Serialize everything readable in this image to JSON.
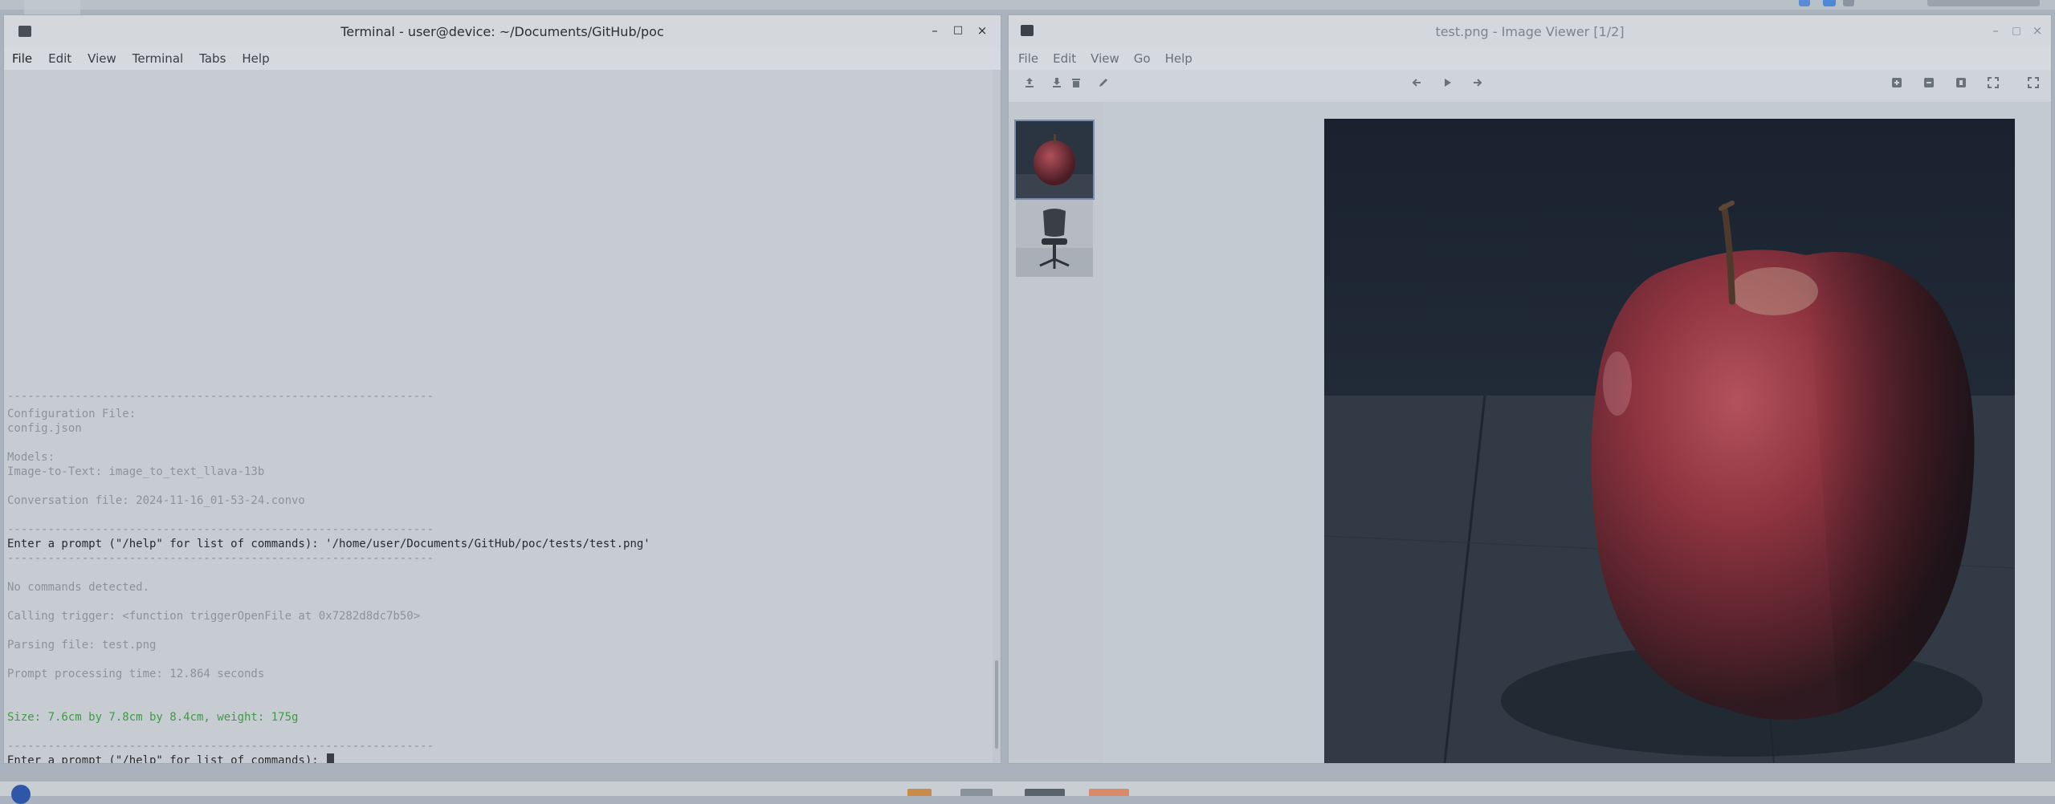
{
  "terminal": {
    "title": "Terminal - user@device: ~/Documents/GitHub/poc",
    "menu": [
      "File",
      "Edit",
      "View",
      "Terminal",
      "Tabs",
      "Help"
    ],
    "controls": {
      "minimize": "–",
      "maximize": "□",
      "close": "×"
    },
    "lines": {
      "sep1": "---------------------------------------------------------------",
      "config_label": "Configuration File:",
      "config_value": "config.json",
      "models_label": "Models:",
      "model_line": "Image-to-Text: image_to_text_llava-13b",
      "conversation": "Conversation file: 2024-11-16_01-53-24.convo",
      "sep2": "---------------------------------------------------------------",
      "prompt1": "Enter a prompt (\"/help\" for list of commands): '/home/user/Documents/GitHub/poc/tests/test.png'",
      "sep3": "---------------------------------------------------------------",
      "no_commands": "No commands detected.",
      "calling": "Calling trigger: <function triggerOpenFile at 0x7282d8dc7b50>",
      "parsing": "Parsing file: test.png",
      "processing": "Prompt processing time: 12.864 seconds",
      "result": "Size: 7.6cm by 7.8cm by 8.4cm, weight: 175g",
      "sep4": "---------------------------------------------------------------",
      "prompt2": "Enter a prompt (\"/help\" for list of commands): "
    }
  },
  "viewer": {
    "title": "test.png - Image Viewer [1/2]",
    "menu": [
      "File",
      "Edit",
      "View",
      "Go",
      "Help"
    ],
    "controls": {
      "minimize": "–",
      "maximize": "□",
      "close": "×"
    },
    "toolbar_icons": [
      "open-icon",
      "save-icon",
      "trash-icon",
      "edit-icon",
      "back-icon",
      "play-icon",
      "forward-icon",
      "zoom-in-icon",
      "zoom-out-icon",
      "zoom-fit-icon",
      "zoom-100-icon",
      "fullscreen-icon"
    ],
    "thumbnails": [
      "apple",
      "office-chair"
    ],
    "selected_thumbnail": 0
  }
}
